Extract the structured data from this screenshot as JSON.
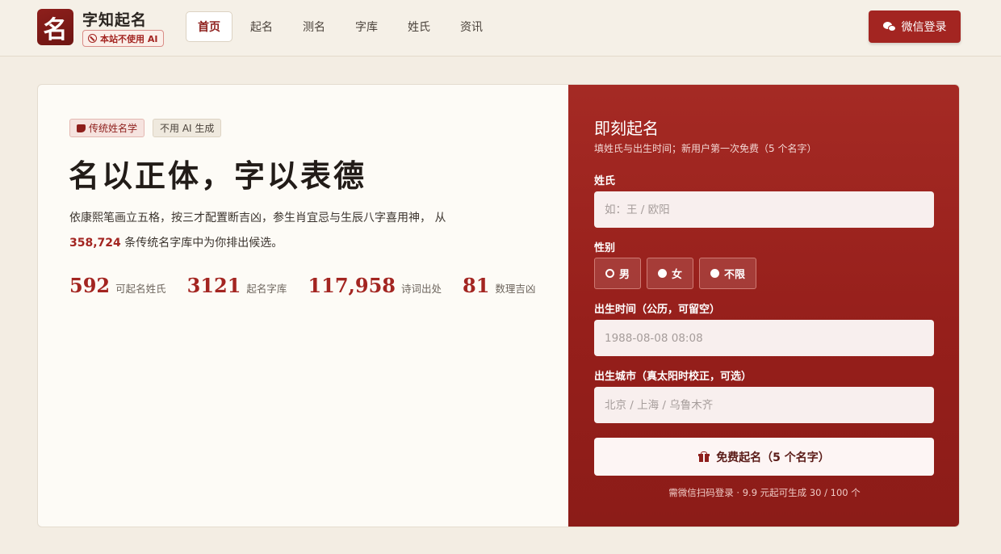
{
  "header": {
    "logo_char": "名",
    "brand": "字知起名",
    "badge": "本站不使用 AI",
    "nav": [
      {
        "label": "首页",
        "active": true
      },
      {
        "label": "起名",
        "active": false
      },
      {
        "label": "测名",
        "active": false
      },
      {
        "label": "字库",
        "active": false
      },
      {
        "label": "姓氏",
        "active": false
      },
      {
        "label": "资讯",
        "active": false
      }
    ],
    "login_label": "微信登录"
  },
  "hero": {
    "tags": [
      "传统姓名学",
      "不用 AI 生成"
    ],
    "headline": "名以正体，字以表德",
    "desc_part1": "依康熙笔画立五格，按三才配置断吉凶，参生肖宜忌与生辰八字喜用神， 从",
    "desc_highlight": "358,724",
    "desc_part2": " 条传统名字库中为你排出候选。",
    "stats": [
      {
        "value": "592",
        "label": "可起名姓氏"
      },
      {
        "value": "3121",
        "label": "起名字库"
      },
      {
        "value": "117,958",
        "label": "诗词出处"
      },
      {
        "value": "81",
        "label": "数理吉凶"
      }
    ]
  },
  "form": {
    "title": "即刻起名",
    "subtitle": "填姓氏与出生时间；新用户第一次免费（5 个名字）",
    "surname_label": "姓氏",
    "surname_placeholder": "如：王 / 欧阳",
    "gender_label": "性别",
    "gender_options": [
      "男",
      "女",
      "不限"
    ],
    "gender_selected": "男",
    "birth_label": "出生时间（公历，可留空）",
    "birth_placeholder": "1988-08-08 08:08",
    "city_label": "出生城市（真太阳时校正，可选）",
    "city_placeholder": "北京 / 上海 / 乌鲁木齐",
    "submit_label": "免费起名（5 个名字）",
    "footnote": "需微信扫码登录 · 9.9 元起可生成 30 / 100 个"
  },
  "colors": {
    "brand_red": "#a32521",
    "dark_red": "#8e1f1c",
    "background": "#f3ede3"
  }
}
